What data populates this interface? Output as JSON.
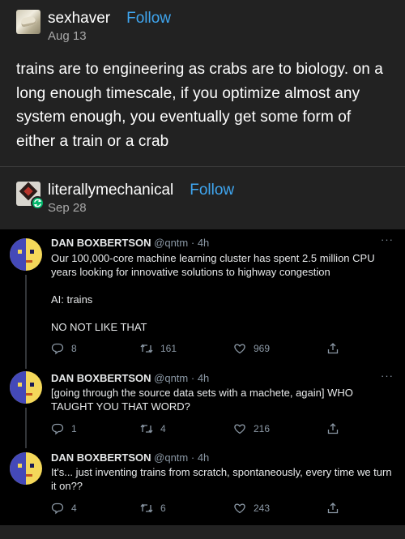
{
  "posts": [
    {
      "username": "sexhaver",
      "follow_label": "Follow",
      "date": "Aug 13",
      "text": "trains are to engineering as crabs are to biology. on a long enough timescale, if you optimize almost any system enough, you eventually get some form of either a train or a crab"
    },
    {
      "username": "literallymechanical",
      "follow_label": "Follow",
      "date": "Sep 28"
    }
  ],
  "tweets": [
    {
      "name": "DAN BOXBERTSON",
      "handle": "@qntm",
      "time": "· 4h",
      "body": [
        "Our 100,000-core machine learning cluster has spent 2.5 million CPU years looking for innovative solutions to highway congestion",
        "AI: trains",
        "NO NOT LIKE THAT"
      ],
      "replies": "8",
      "retweets": "161",
      "likes": "969"
    },
    {
      "name": "DAN BOXBERTSON",
      "handle": "@qntm",
      "time": "· 4h",
      "body": [
        "[going through the source data sets with a machete, again] WHO TAUGHT YOU THAT WORD?"
      ],
      "replies": "1",
      "retweets": "4",
      "likes": "216"
    },
    {
      "name": "DAN BOXBERTSON",
      "handle": "@qntm",
      "time": "· 4h",
      "body": [
        "It's... just inventing trains from scratch, spontaneously, every time we turn it on??"
      ],
      "replies": "4",
      "retweets": "6",
      "likes": "243"
    }
  ],
  "icons": [
    "reblog-icon",
    "reply-icon",
    "retweet-icon",
    "like-icon",
    "share-icon",
    "more-icon"
  ],
  "colors": {
    "follow": "#3fa6f0",
    "reblog_badge": "#00b86b",
    "tumblr_bg": "#222222",
    "tweet_bg": "#000000"
  }
}
